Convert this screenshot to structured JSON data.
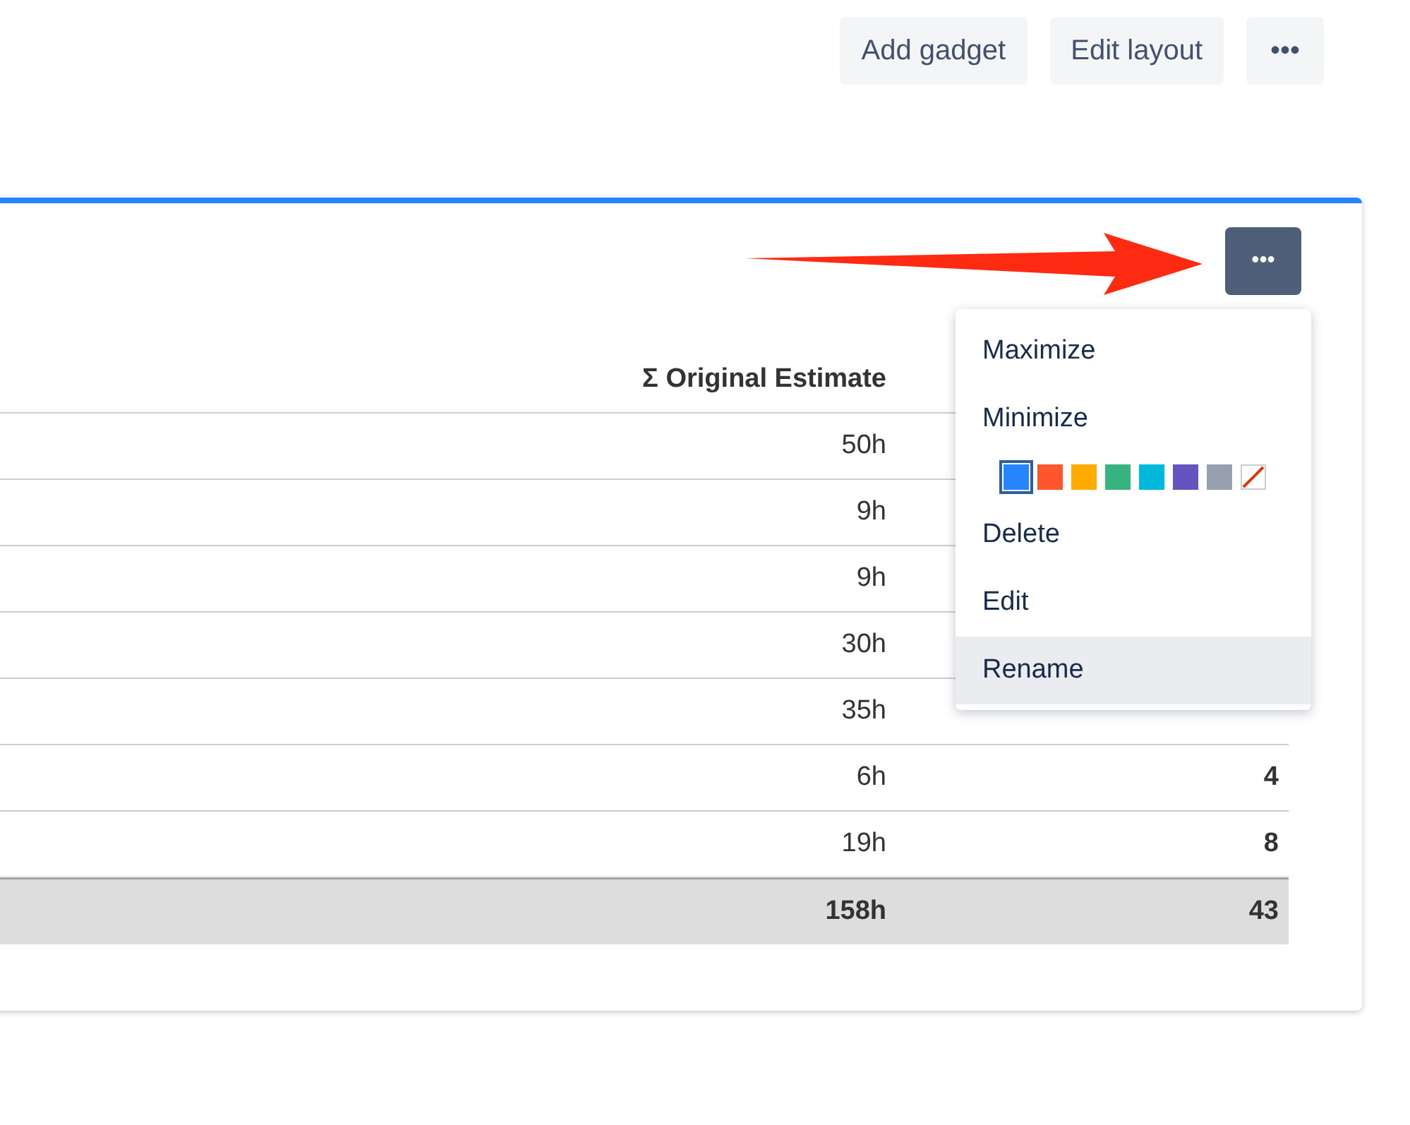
{
  "toolbar": {
    "buttons": [
      {
        "label": "Add gadget"
      },
      {
        "label": "Edit layout"
      },
      {
        "label": "•••"
      }
    ]
  },
  "gadget": {
    "menu_button": "•••",
    "menu": {
      "items": [
        {
          "kind": "item",
          "label": "Maximize",
          "highlighted": false
        },
        {
          "kind": "item",
          "label": "Minimize",
          "highlighted": false
        },
        {
          "kind": "colors",
          "swatches": [
            {
              "kind": "color",
              "color": "#2684ff",
              "selected": true
            },
            {
              "kind": "color",
              "color": "#ff5630",
              "selected": false
            },
            {
              "kind": "color",
              "color": "#ffab00",
              "selected": false
            },
            {
              "kind": "color",
              "color": "#36b37e",
              "selected": false
            },
            {
              "kind": "color",
              "color": "#00b8d9",
              "selected": false
            },
            {
              "kind": "color",
              "color": "#6554c0",
              "selected": false
            },
            {
              "kind": "color",
              "color": "#97a0af",
              "selected": false
            },
            {
              "kind": "none",
              "selected": false
            }
          ]
        },
        {
          "kind": "item",
          "label": "Delete",
          "highlighted": false
        },
        {
          "kind": "item",
          "label": "Edit",
          "highlighted": false
        },
        {
          "kind": "item",
          "label": "Rename",
          "highlighted": true
        }
      ]
    },
    "table": {
      "columns": [
        "Σ Original Estimate"
      ],
      "rows": [
        {
          "estimate": "50h"
        },
        {
          "estimate": "9h"
        },
        {
          "estimate": "9h"
        },
        {
          "estimate": "30h"
        },
        {
          "estimate": "35h"
        },
        {
          "estimate": "6h",
          "column_2": "4"
        },
        {
          "estimate": "19h",
          "column_2": "8"
        }
      ],
      "total": {
        "estimate": "158h",
        "column_2": "43"
      }
    }
  }
}
